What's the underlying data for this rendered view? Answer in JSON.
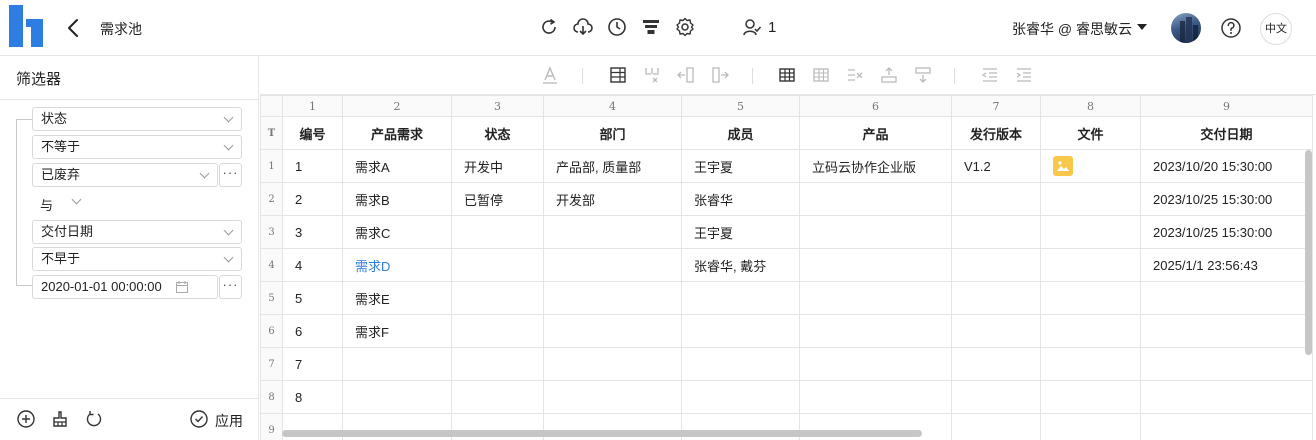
{
  "header": {
    "page_title": "需求池",
    "member_count": "1",
    "user": "张睿华 @ 睿思敏云",
    "lang": "中文",
    "logo_color": "#2e7de0"
  },
  "filter": {
    "title": "筛选器",
    "conditions": [
      {
        "field": "状态",
        "operator": "不等于",
        "value": "已废弃"
      },
      {
        "field": "交付日期",
        "operator": "不早于",
        "value": "2020-01-01 00:00:00"
      }
    ],
    "conjunction": "与",
    "more_label": "···",
    "apply_label": "应用"
  },
  "sheet": {
    "column_numbers": [
      "1",
      "2",
      "3",
      "4",
      "5",
      "6",
      "7",
      "8",
      "9"
    ],
    "header_marker": "T",
    "columns": [
      "编号",
      "产品需求",
      "状态",
      "部门",
      "成员",
      "产品",
      "发行版本",
      "文件",
      "交付日期"
    ],
    "rows": [
      {
        "rn": "1",
        "cells": [
          "1",
          "需求A",
          "开发中",
          "产品部, 质量部",
          "王宇夏",
          "立码云协作企业版",
          "V1.2",
          "",
          "2023/10/20 15:30:00"
        ],
        "has_file": true
      },
      {
        "rn": "2",
        "cells": [
          "2",
          "需求B",
          "已暂停",
          "开发部",
          "张睿华",
          "",
          "",
          "",
          "2023/10/25 15:30:00"
        ],
        "has_file": false
      },
      {
        "rn": "3",
        "cells": [
          "3",
          "需求C",
          "",
          "",
          "王宇夏",
          "",
          "",
          "",
          "2023/10/25 15:30:00"
        ],
        "has_file": false
      },
      {
        "rn": "4",
        "cells": [
          "4",
          "需求D",
          "",
          "",
          "张睿华, 戴芬",
          "",
          "",
          "",
          "2025/1/1 23:56:43"
        ],
        "has_file": false,
        "link": true
      },
      {
        "rn": "5",
        "cells": [
          "5",
          "需求E",
          "",
          "",
          "",
          "",
          "",
          "",
          ""
        ],
        "has_file": false
      },
      {
        "rn": "6",
        "cells": [
          "6",
          "需求F",
          "",
          "",
          "",
          "",
          "",
          "",
          ""
        ],
        "has_file": false
      },
      {
        "rn": "7",
        "cells": [
          "7",
          "",
          "",
          "",
          "",
          "",
          "",
          "",
          ""
        ],
        "has_file": false
      },
      {
        "rn": "8",
        "cells": [
          "8",
          "",
          "",
          "",
          "",
          "",
          "",
          "",
          ""
        ],
        "has_file": false
      },
      {
        "rn": "9",
        "cells": [
          "",
          "",
          "",
          "",
          "",
          "",
          "",
          "",
          ""
        ],
        "has_file": false
      }
    ],
    "file_chip_color": "#f9c84b",
    "link_color": "#2e7de0"
  }
}
